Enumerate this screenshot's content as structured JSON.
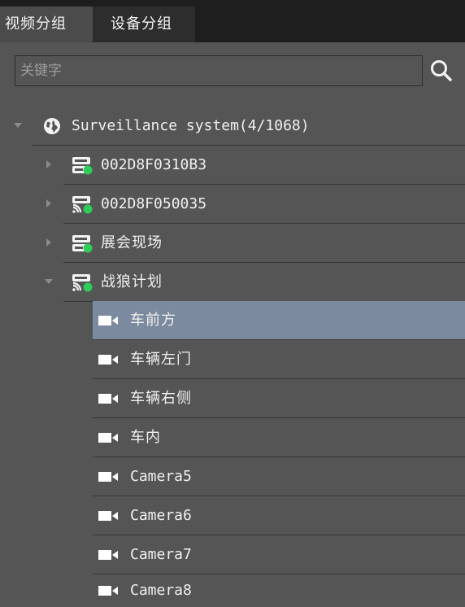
{
  "tabs": [
    {
      "label": "视频分组",
      "active": true
    },
    {
      "label": "设备分组",
      "active": false
    }
  ],
  "search": {
    "placeholder": "关键字"
  },
  "tree": {
    "root": {
      "label": "Surveillance system(4/1068)",
      "expanded": true
    },
    "devices": [
      {
        "label": "002D8F0310B3",
        "icon": "device-online-icon",
        "expanded": false
      },
      {
        "label": "002D8F050035",
        "icon": "wireless-device-online-icon",
        "expanded": false
      },
      {
        "label": "展会现场",
        "icon": "device-online-icon",
        "expanded": false
      },
      {
        "label": "战狼计划",
        "icon": "wireless-device-online-icon",
        "expanded": true
      }
    ],
    "cameras": [
      {
        "label": "车前方",
        "selected": true
      },
      {
        "label": "车辆左门",
        "selected": false
      },
      {
        "label": "车辆右侧",
        "selected": false
      },
      {
        "label": "车内",
        "selected": false
      },
      {
        "label": "Camera5",
        "selected": false
      },
      {
        "label": "Camera6",
        "selected": false
      },
      {
        "label": "Camera7",
        "selected": false
      },
      {
        "label": "Camera8",
        "selected": false
      }
    ]
  },
  "colors": {
    "tabbar": "#1e1e1e",
    "active_tab": "#4b4b4b",
    "panel": "#555555",
    "selected_row": "#7b8a9e",
    "online_dot": "#2ecc5a"
  }
}
